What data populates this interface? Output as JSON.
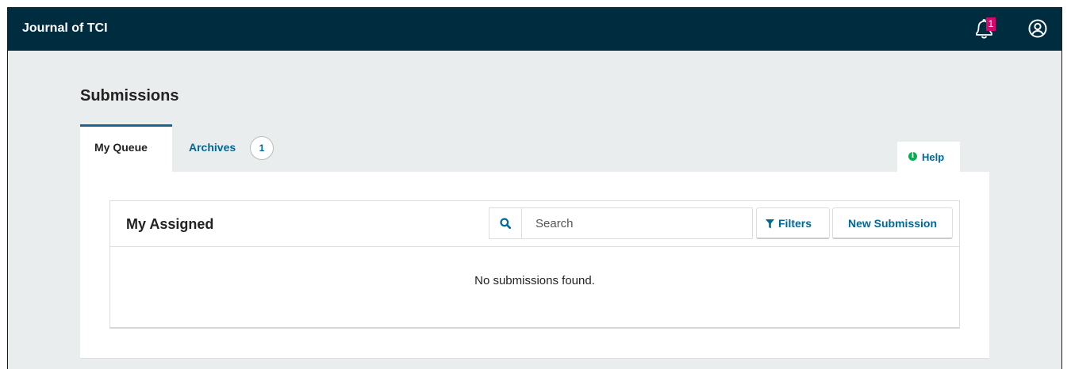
{
  "header": {
    "journal_title": "Journal of TCI",
    "notification_count": "1",
    "icons": {
      "notifications": "bell-icon",
      "user": "user-circle-icon"
    },
    "background_color": "#002c40",
    "badge_color": "#d00a6c"
  },
  "page": {
    "title": "Submissions"
  },
  "tabs": [
    {
      "label": "My Queue",
      "active": true
    },
    {
      "label": "Archives",
      "count": "1",
      "active": false
    }
  ],
  "help": {
    "label": "Help",
    "icon": "info-icon"
  },
  "list": {
    "title": "My Assigned",
    "search_placeholder": "Search",
    "search_value": "",
    "filters_label": "Filters",
    "new_submission_label": "New Submission",
    "empty_message": "No submissions found.",
    "icons": {
      "search": "search-icon",
      "filter": "filter-icon"
    }
  },
  "colors": {
    "accent": "#006798",
    "active_tab_border": "#1e6292",
    "page_background": "#eaedee"
  }
}
